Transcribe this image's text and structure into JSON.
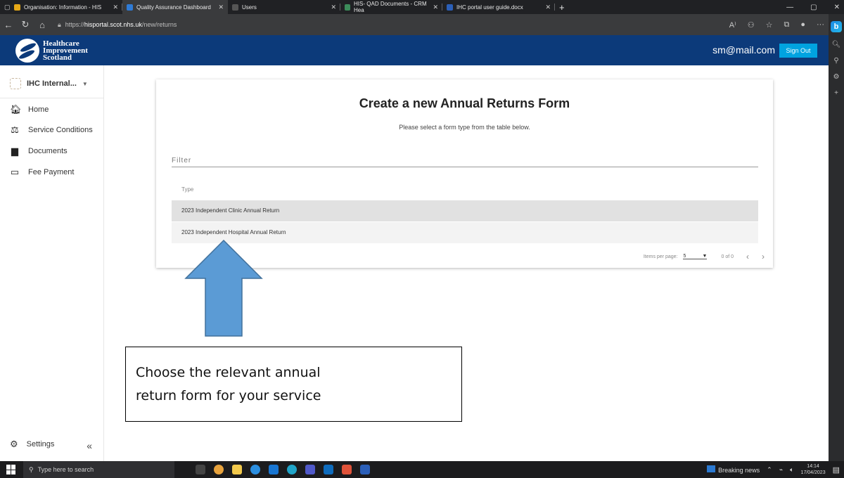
{
  "browser": {
    "tabs": [
      {
        "label": "Organisation: Information - HIS",
        "color": "#e6a817",
        "active": false
      },
      {
        "label": "Quality Assurance Dashboard",
        "color": "#2f7bd6",
        "active": true
      },
      {
        "label": "Users",
        "color": "#3a3b3d",
        "active": false
      },
      {
        "label": "HIS- QAD Documents - CRM Hea",
        "color": "#3c8c5a",
        "active": false
      },
      {
        "label": "IHC portal user guide.docx",
        "color": "#2b5fb8",
        "active": false
      }
    ],
    "url_prefix": "https://",
    "url_host": "hisportal.scot.nhs.uk",
    "url_path": "/new/returns"
  },
  "header": {
    "logo_line1": "Healthcare",
    "logo_line2": "Improvement",
    "logo_line3": "Scotland",
    "user_email": "sm@mail.com",
    "signout_label": "Sign Out"
  },
  "sidebar": {
    "org_name": "IHC Internal...",
    "items": [
      {
        "label": "Home",
        "icon": "home-icon"
      },
      {
        "label": "Service Conditions",
        "icon": "gavel-icon"
      },
      {
        "label": "Documents",
        "icon": "document-icon"
      },
      {
        "label": "Fee Payment",
        "icon": "card-icon"
      }
    ],
    "settings_label": "Settings",
    "collapse_glyph": "«"
  },
  "main": {
    "title": "Create a new Annual Returns Form",
    "subtitle": "Please select a form type from the table below.",
    "filter_label": "Filter",
    "column_header": "Type",
    "rows": [
      "2023 Independent Clinic Annual Return",
      "2023 Independent Hospital Annual Return"
    ],
    "pager_label": "Items per page:",
    "pager_value": "5",
    "pager_range": "0 of 0"
  },
  "annotation": {
    "line1": "Choose the relevant annual",
    "line2": "return form for your service"
  },
  "taskbar": {
    "search_placeholder": "Type here to search",
    "news_label": "Breaking news",
    "time": "14:14",
    "date": "17/04/2023"
  }
}
